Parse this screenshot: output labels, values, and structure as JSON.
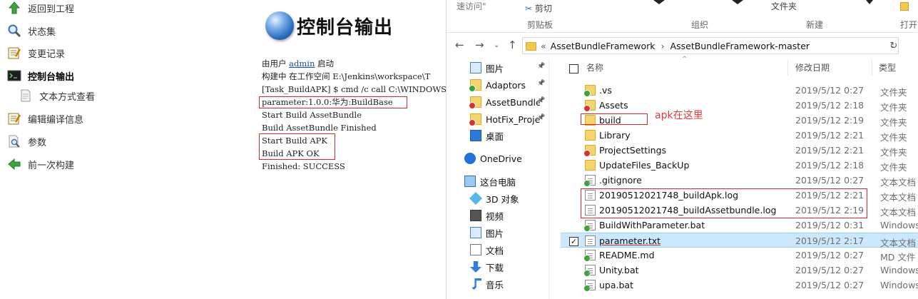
{
  "jenkins": {
    "sidebar": [
      {
        "label": "返回到工程",
        "icon": "up-arrow-icon"
      },
      {
        "label": "状态集",
        "icon": "magnifier-icon"
      },
      {
        "label": "变更记录",
        "icon": "notepad-icon"
      },
      {
        "label": "控制台输出",
        "icon": "terminal-icon"
      },
      {
        "label": "文本方式查看",
        "icon": "document-icon"
      },
      {
        "label": "编辑编译信息",
        "icon": "notepad-edit-icon"
      },
      {
        "label": "参数",
        "icon": "document-search-icon"
      },
      {
        "label": "前一次构建",
        "icon": "left-arrow-icon"
      }
    ],
    "page_title": "控制台输出",
    "console": {
      "line1_prefix": "由用户 ",
      "line1_user": "admin",
      "line1_suffix": " 启动",
      "line2": "构建中 在工作空间 E:\\Jenkins\\workspace\\T",
      "line3": "[Task_BuildAPK] $ cmd /c call C:\\WINDOWS",
      "line4": "parameter:1.0.0:华为:BuildBase",
      "line5": "Start Build AssetBundle",
      "line6": "Build AssetBundle Finished",
      "line7": "Start Build APK",
      "line8": "Build APK OK",
      "line9": "Finished: SUCCESS"
    }
  },
  "explorer": {
    "ribbon": {
      "quick_access": "速访问\"",
      "cut": "剪切",
      "clipboard": "剪贴板",
      "organize": "组织",
      "folder": "文件夹",
      "new": "新建",
      "open": "打开"
    },
    "breadcrumb": {
      "overflow": "«",
      "part1": "AssetBundleFramework",
      "sep": "›",
      "part2": "AssetBundleFramework-master"
    },
    "nav": [
      {
        "label": "图片",
        "pinned": true,
        "icon": "pictures-icon"
      },
      {
        "label": "Adaptors",
        "pinned": true,
        "icon": "folder-synced-icon"
      },
      {
        "label": "AssetBundle",
        "pinned": true,
        "icon": "folder-error-icon"
      },
      {
        "label": "HotFix_Proje",
        "pinned": true,
        "icon": "folder-error-icon"
      },
      {
        "label": "桌面",
        "pinned": false,
        "icon": "desktop-icon"
      },
      {
        "label": "OneDrive",
        "pinned": false,
        "icon": "cloud-icon"
      },
      {
        "label": "这台电脑",
        "pinned": false,
        "icon": "computer-icon"
      },
      {
        "label": "3D 对象",
        "pinned": false,
        "icon": "3d-objects-icon"
      },
      {
        "label": "视频",
        "pinned": false,
        "icon": "video-icon"
      },
      {
        "label": "图片",
        "pinned": false,
        "icon": "pictures-icon"
      },
      {
        "label": "文档",
        "pinned": false,
        "icon": "documents-icon"
      },
      {
        "label": "下载",
        "pinned": false,
        "icon": "download-icon"
      },
      {
        "label": "音乐",
        "pinned": false,
        "icon": "music-icon"
      }
    ],
    "columns": {
      "name": "名称",
      "date": "修改日期",
      "type": "类型"
    },
    "files": [
      {
        "name": ".vs",
        "date": "2019/5/12 0:27",
        "type": "文件夹",
        "kind": "folder",
        "status": "green"
      },
      {
        "name": "Assets",
        "date": "2019/5/12 2:18",
        "type": "文件夹",
        "kind": "folder",
        "status": "red"
      },
      {
        "name": "build",
        "date": "2019/5/12 2:19",
        "type": "文件夹",
        "kind": "folder",
        "status": ""
      },
      {
        "name": "Library",
        "date": "2019/5/12 2:21",
        "type": "文件夹",
        "kind": "folder",
        "status": ""
      },
      {
        "name": "ProjectSettings",
        "date": "2019/5/12 2:21",
        "type": "文件夹",
        "kind": "folder",
        "status": "red"
      },
      {
        "name": "UpdateFiles_BackUp",
        "date": "2019/5/12 2:18",
        "type": "文件夹",
        "kind": "folder",
        "status": ""
      },
      {
        "name": ".gitignore",
        "date": "2019/5/12 0:27",
        "type": "文本文档",
        "kind": "file",
        "status": "green"
      },
      {
        "name": "20190512021748_buildApk.log",
        "date": "2019/5/12 2:21",
        "type": "文本文档",
        "kind": "file",
        "status": ""
      },
      {
        "name": "20190512021748_buildAssetbundle.log",
        "date": "2019/5/12 2:19",
        "type": "文本文档",
        "kind": "file",
        "status": ""
      },
      {
        "name": "BuildWithParameter.bat",
        "date": "2019/5/12 0:31",
        "type": "Windows",
        "kind": "file",
        "status": "green"
      },
      {
        "name": "parameter.txt",
        "date": "2019/5/12 2:17",
        "type": "文本文档",
        "kind": "file",
        "status": "",
        "selected": true
      },
      {
        "name": "README.md",
        "date": "2019/5/12 0:27",
        "type": "MD 文件",
        "kind": "file",
        "status": "green"
      },
      {
        "name": "Unity.bat",
        "date": "2019/5/12 0:27",
        "type": "Windows",
        "kind": "file",
        "status": "green"
      },
      {
        "name": "upa.bat",
        "date": "2019/5/12 0:27",
        "type": "Windows",
        "kind": "file",
        "status": "green"
      }
    ],
    "annotation": "apk在这里"
  }
}
